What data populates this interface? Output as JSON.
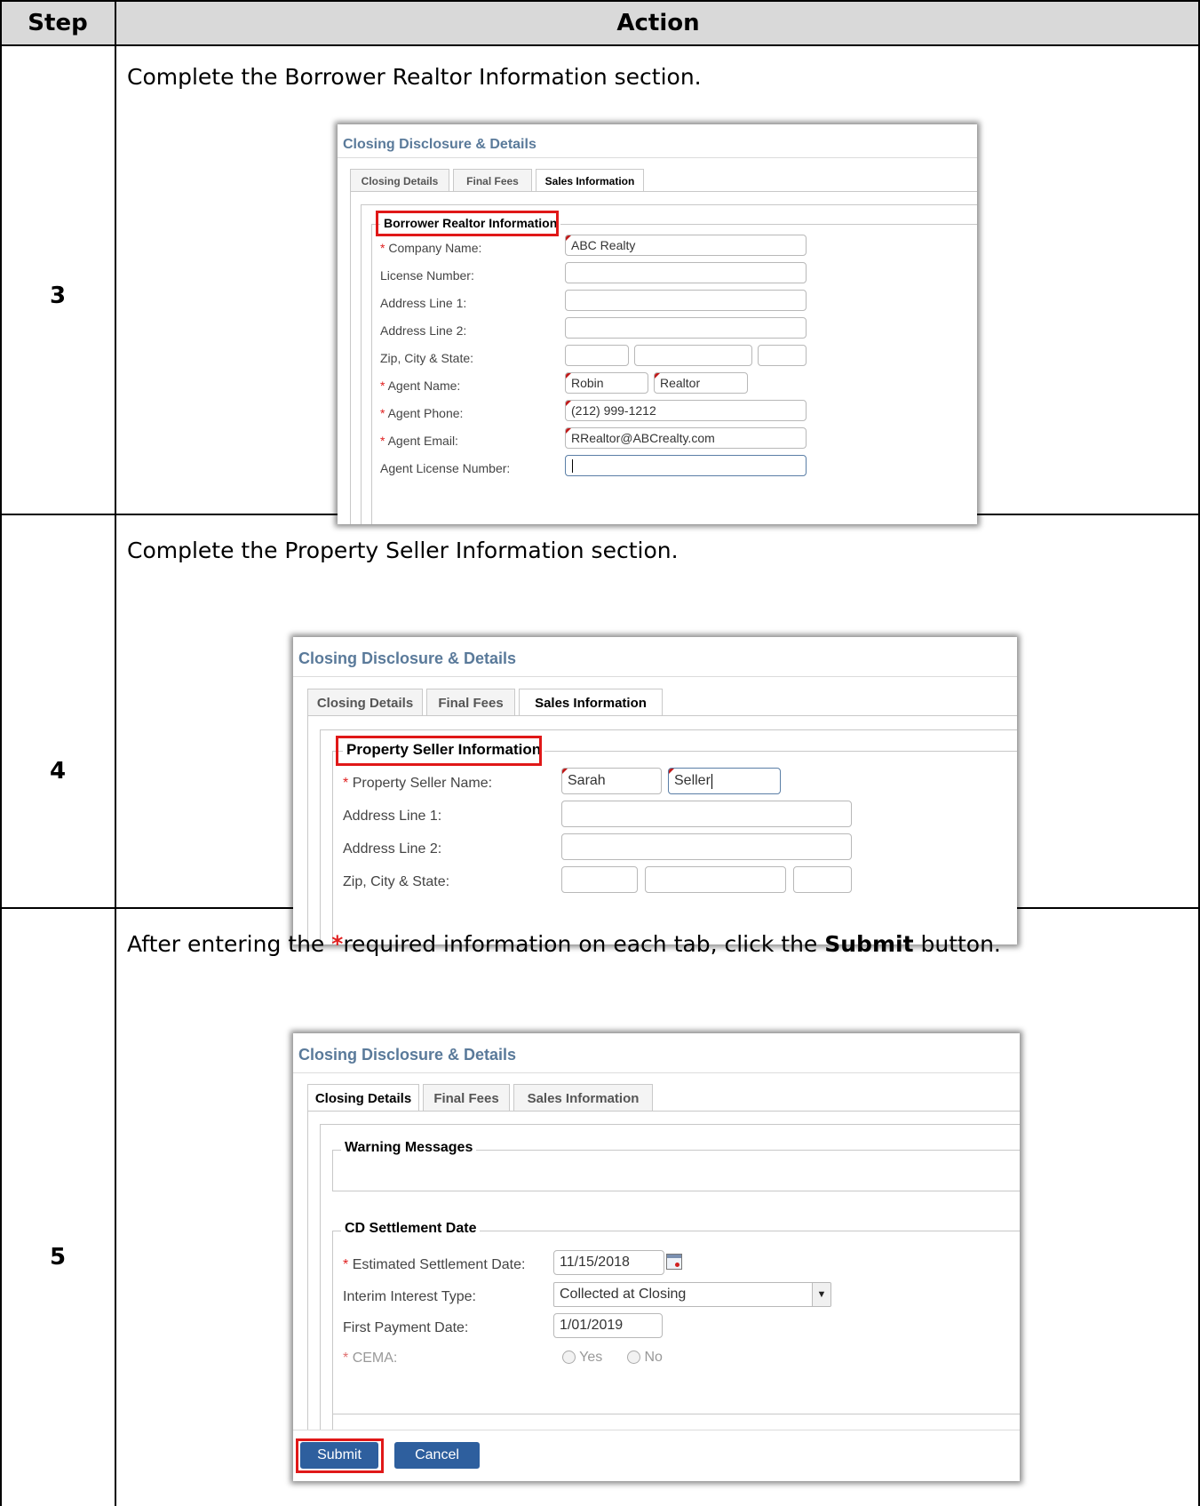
{
  "table": {
    "header_step": "Step",
    "header_action": "Action"
  },
  "step3": {
    "number": "3",
    "instruction": "Complete the Borrower Realtor Information section.",
    "window_title": "Closing Disclosure & Details",
    "tabs": [
      "Closing Details",
      "Final Fees",
      "Sales Information"
    ],
    "section_title": "Borrower Realtor Information",
    "required_mark": "*",
    "fields": {
      "company_label": "Company Name:",
      "company_value": "ABC Realty",
      "license_label": "License Number:",
      "addr1_label": "Address Line 1:",
      "addr2_label": "Address Line 2:",
      "zip_label": "Zip, City & State:",
      "agent_name_label": "Agent Name:",
      "agent_first": "Robin",
      "agent_last": "Realtor",
      "agent_phone_label": "Agent Phone:",
      "agent_phone": "(212) 999-1212",
      "agent_email_label": "Agent Email:",
      "agent_email": "RRealtor@ABCrealty.com",
      "agent_license_label": "Agent License Number:"
    }
  },
  "step4": {
    "number": "4",
    "instruction": "Complete the Property Seller Information section.",
    "window_title": "Closing Disclosure & Details",
    "tabs": [
      "Closing Details",
      "Final Fees",
      "Sales Information"
    ],
    "section_title": "Property Seller Information",
    "required_mark": "*",
    "fields": {
      "seller_label": "Property Seller Name:",
      "seller_first": "Sarah",
      "seller_last": "Seller",
      "addr1_label": "Address Line 1:",
      "addr2_label": "Address Line 2:",
      "zip_label": "Zip, City & State:"
    }
  },
  "step5": {
    "number": "5",
    "instruction_pre": "After entering the ",
    "instruction_star": "*",
    "instruction_mid": "required information on each tab, click the ",
    "instruction_bold": "Submit",
    "instruction_post": " button.",
    "window_title": "Closing Disclosure & Details",
    "tabs": [
      "Closing Details",
      "Final Fees",
      "Sales Information"
    ],
    "warning_title": "Warning Messages",
    "settlement_title": "CD Settlement Date",
    "required_mark": "*",
    "fields": {
      "est_date_label": "Estimated Settlement Date:",
      "est_date_value": "11/15/2018",
      "interest_label": "Interim Interest Type:",
      "interest_value": "Collected at Closing",
      "first_payment_label": "First Payment Date:",
      "first_payment_value": "1/01/2019",
      "cema_label": "CEMA:",
      "yes_label": "Yes",
      "no_label": "No"
    },
    "submit_label": "Submit",
    "cancel_label": "Cancel"
  }
}
